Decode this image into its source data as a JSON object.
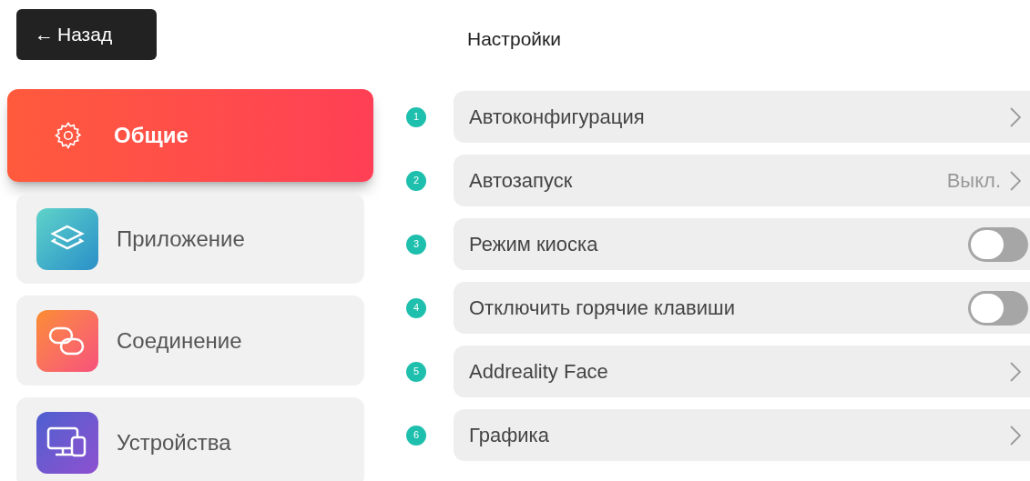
{
  "back_button": {
    "arrow": "←",
    "label": "Назад"
  },
  "title": "Настройки",
  "sidebar": {
    "items": [
      {
        "label": "Общие",
        "selected": true
      },
      {
        "label": "Приложение",
        "selected": false
      },
      {
        "label": "Соединение",
        "selected": false
      },
      {
        "label": "Устройства",
        "selected": false
      }
    ]
  },
  "settings": [
    {
      "number": "1",
      "label": "Автоконфигурация",
      "kind": "link"
    },
    {
      "number": "2",
      "label": "Автозапуск",
      "kind": "link",
      "value": "Выкл."
    },
    {
      "number": "3",
      "label": "Режим киоска",
      "kind": "toggle",
      "on": false
    },
    {
      "number": "4",
      "label": "Отключить горячие клавиши",
      "kind": "toggle",
      "on": false
    },
    {
      "number": "5",
      "label": "Addreality Face",
      "kind": "link"
    },
    {
      "number": "6",
      "label": "Графика",
      "kind": "link"
    }
  ]
}
